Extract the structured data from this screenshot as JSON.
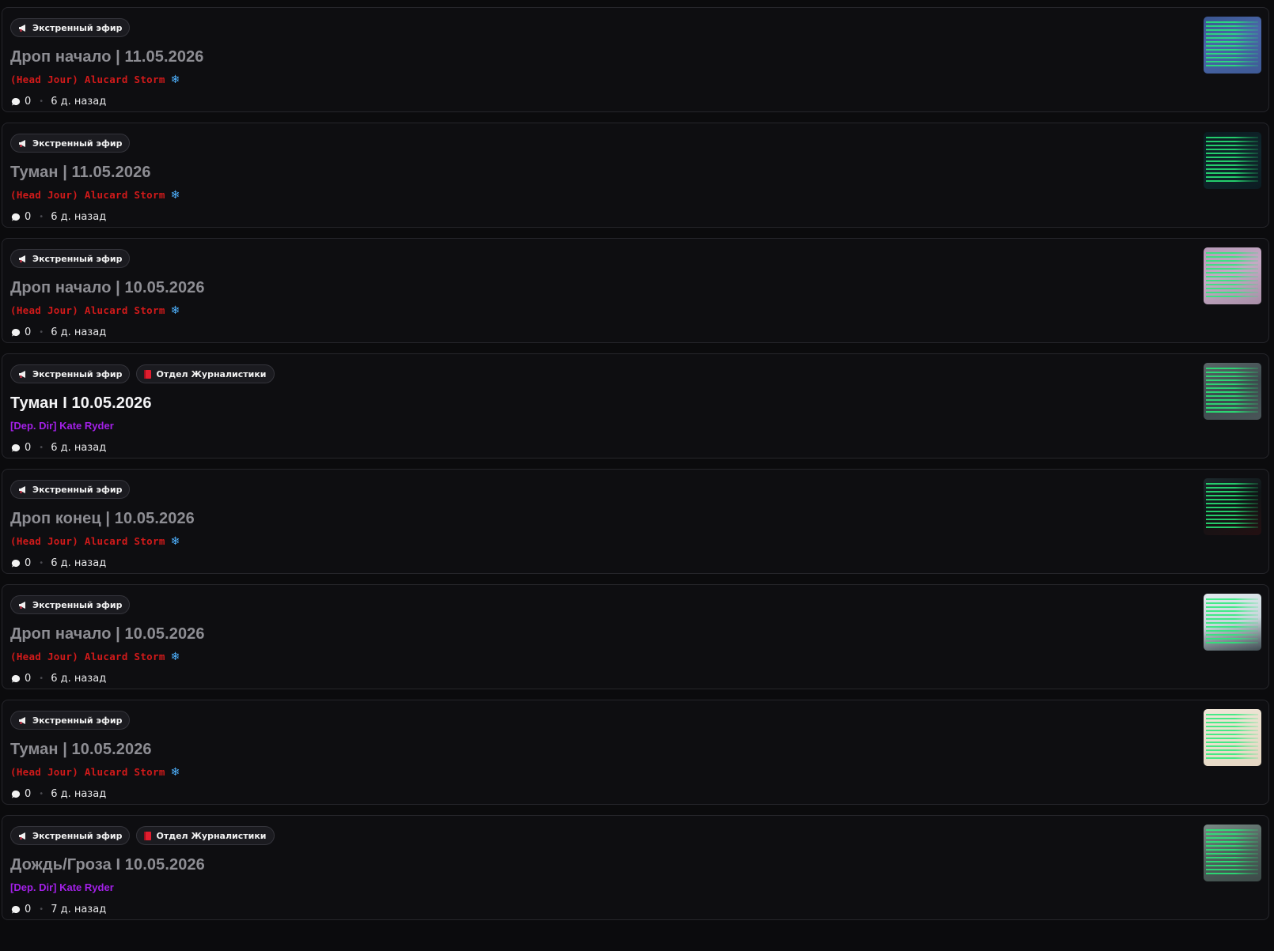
{
  "icons": {
    "tag_broadcast": "megaphone-icon",
    "tag_department": "book-icon",
    "author_badge": "snowflake-icon",
    "comments": "speech-bubble-icon"
  },
  "colors": {
    "background": "#0b0b0d",
    "card": "#0e0e11",
    "author_red": "#d11a1a",
    "author_purple": "#a320e8",
    "snowflake": "#4fb2ff"
  },
  "posts": [
    {
      "tags": [
        "Экстренный эфир"
      ],
      "title": "Дроп начало | 11.05.2026",
      "author": "(Head Jour) Alucard Storm",
      "comments": "0",
      "time": "6 д. назад"
    },
    {
      "tags": [
        "Экстренный эфир"
      ],
      "title": "Туман | 11.05.2026",
      "author": "(Head Jour) Alucard Storm",
      "comments": "0",
      "time": "6 д. назад"
    },
    {
      "tags": [
        "Экстренный эфир"
      ],
      "title": "Дроп начало | 10.05.2026",
      "author": "(Head Jour) Alucard Storm",
      "comments": "0",
      "time": "6 д. назад"
    },
    {
      "tags": [
        "Экстренный эфир",
        "Отдел Журналистики"
      ],
      "title": "Туман I 10.05.2026",
      "author": "[Dep. Dir] Kate Ryder",
      "comments": "0",
      "time": "6 д. назад"
    },
    {
      "tags": [
        "Экстренный эфир"
      ],
      "title": "Дроп конец | 10.05.2026",
      "author": "(Head Jour) Alucard Storm",
      "comments": "0",
      "time": "6 д. назад"
    },
    {
      "tags": [
        "Экстренный эфир"
      ],
      "title": "Дроп начало | 10.05.2026",
      "author": "(Head Jour) Alucard Storm",
      "comments": "0",
      "time": "6 д. назад"
    },
    {
      "tags": [
        "Экстренный эфир"
      ],
      "title": "Туман | 10.05.2026",
      "author": "(Head Jour) Alucard Storm",
      "comments": "0",
      "time": "6 д. назад"
    },
    {
      "tags": [
        "Экстренный эфир",
        "Отдел Журналистики"
      ],
      "title": "Дождь/Гроза I 10.05.2026",
      "author": "[Dep. Dir] Kate Ryder",
      "comments": "0",
      "time": "7 д. назад"
    }
  ]
}
